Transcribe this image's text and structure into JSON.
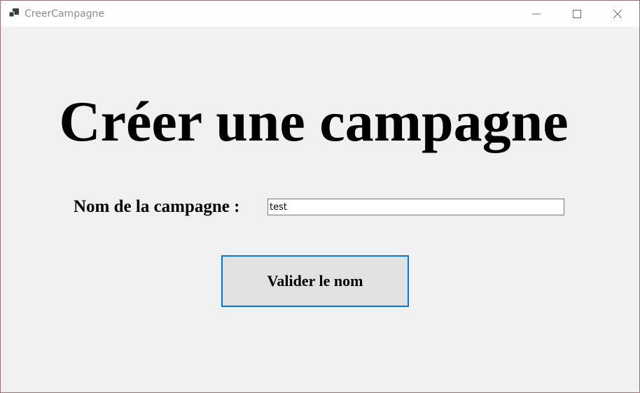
{
  "window": {
    "title": "CreerCampagne",
    "icon": "app-window-icon",
    "controls": {
      "minimize_icon": "minimize-icon",
      "maximize_icon": "maximize-icon",
      "close_icon": "close-icon"
    }
  },
  "form": {
    "heading": "Créer une campagne",
    "name_label": "Nom de la campagne :",
    "name_value": "test",
    "submit_label": "Valider le nom"
  },
  "colors": {
    "background": "#f0f0f0",
    "titlebar": "#ffffff",
    "button_border_focus": "#0078d7",
    "button_face": "#e1e1e1"
  }
}
